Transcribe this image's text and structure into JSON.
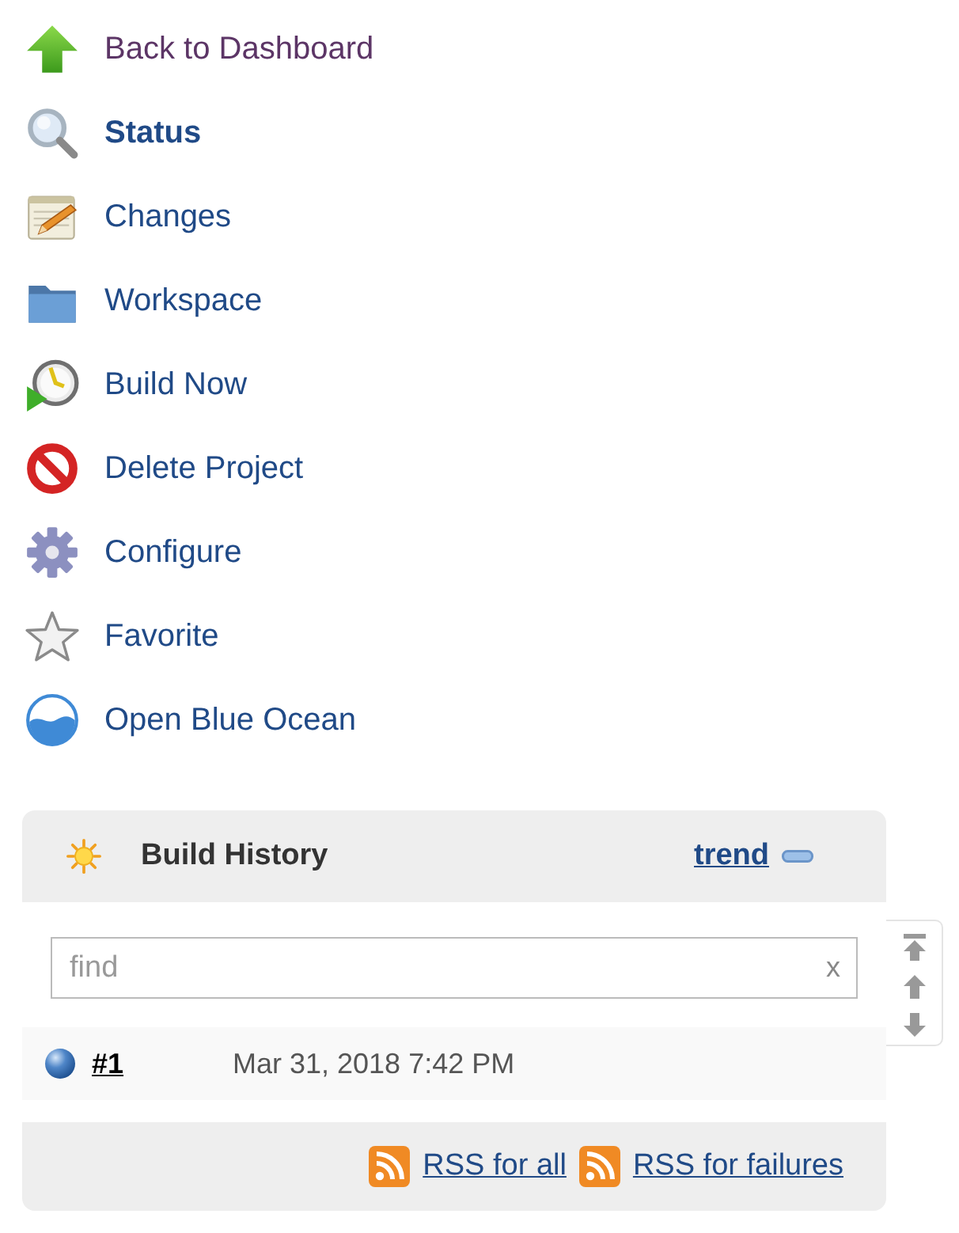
{
  "sidebar": {
    "items": [
      {
        "label": "Back to Dashboard",
        "selected": false,
        "visited": true
      },
      {
        "label": "Status",
        "selected": true,
        "visited": false
      },
      {
        "label": "Changes",
        "selected": false,
        "visited": false
      },
      {
        "label": "Workspace",
        "selected": false,
        "visited": false
      },
      {
        "label": "Build Now",
        "selected": false,
        "visited": false
      },
      {
        "label": "Delete Project",
        "selected": false,
        "visited": false
      },
      {
        "label": "Configure",
        "selected": false,
        "visited": false
      },
      {
        "label": "Favorite",
        "selected": false,
        "visited": false
      },
      {
        "label": "Open Blue Ocean",
        "selected": false,
        "visited": false
      }
    ]
  },
  "build_history": {
    "title": "Build History",
    "trend_link": "trend",
    "search": {
      "placeholder": "find",
      "clear": "x"
    },
    "builds": [
      {
        "number": "#1",
        "time": "Mar 31, 2018 7:42 PM"
      }
    ],
    "feeds": [
      "RSS for all",
      "RSS for failures"
    ]
  }
}
